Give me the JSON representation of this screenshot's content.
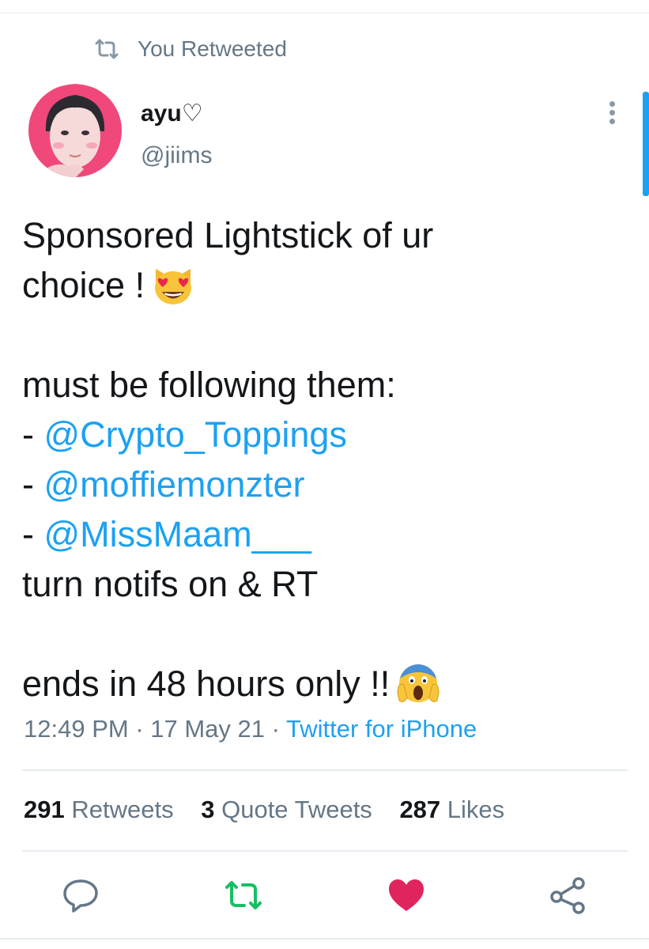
{
  "retweet_banner": {
    "text": "You Retweeted",
    "icon": "retweet-icon"
  },
  "author": {
    "display_name": "ayu♡",
    "handle": "@jiims",
    "avatar": "avatar-photo"
  },
  "tweet": {
    "line1": "Sponsored Lightstick of ur",
    "line2": "choice !",
    "line3": "must be following them:",
    "prefix": "- ",
    "mentions": [
      "@Crypto_Toppings",
      "@moffiemonzter",
      "@MissMaam___"
    ],
    "line4": "turn notifs on & RT",
    "line5": "ends in 48 hours only !!",
    "emoji1": "heart-eyes-cat-emoji",
    "emoji2": "screaming-face-emoji"
  },
  "meta": {
    "time": "12:49 PM",
    "sep": " · ",
    "date": "17 May 21",
    "source": "Twitter for iPhone"
  },
  "stats": {
    "retweets_count": "291",
    "retweets_label": "Retweets",
    "quotes_count": "3",
    "quotes_label": "Quote Tweets",
    "likes_count": "287",
    "likes_label": "Likes"
  },
  "actions": [
    "reply-icon",
    "retweet-icon",
    "like-icon",
    "share-icon"
  ],
  "colors": {
    "accent": "#1da1f2",
    "retweet_active": "#17bf63",
    "like_active": "#e0245e",
    "secondary_text": "#657786"
  }
}
